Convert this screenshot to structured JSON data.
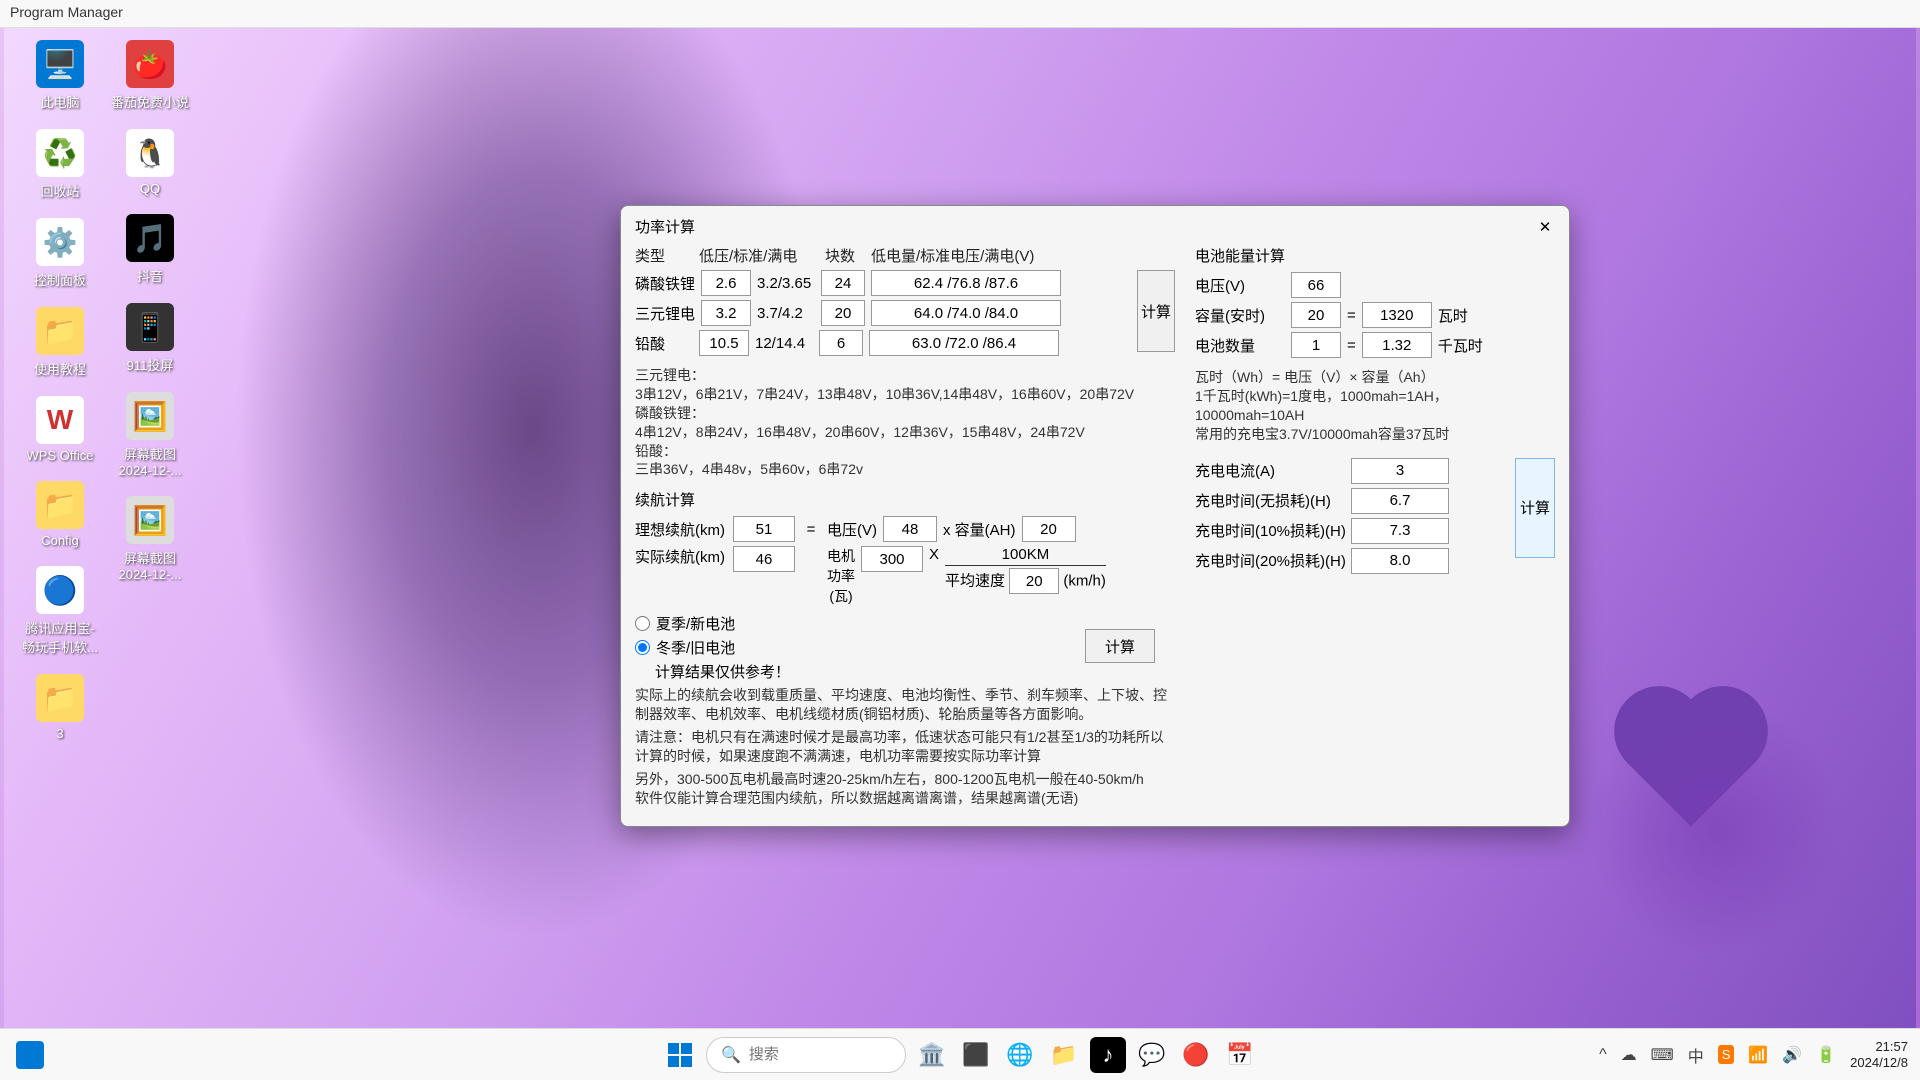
{
  "window_title": "Program Manager",
  "desktop": {
    "col1": [
      {
        "label": "此电脑"
      },
      {
        "label": "回收站"
      },
      {
        "label": "控制面板"
      },
      {
        "label": "使用教程"
      },
      {
        "label": "WPS Office"
      },
      {
        "label": "Config"
      },
      {
        "label": "腾讯应用宝-\n畅玩手机软..."
      },
      {
        "label": "3"
      }
    ],
    "col2": [
      {
        "label": "番茄免费小说"
      },
      {
        "label": "QQ"
      },
      {
        "label": "抖音"
      },
      {
        "label": "911投屏"
      },
      {
        "label": "屏幕截图\n2024-12-..."
      },
      {
        "label": "屏幕截图\n2024-12-..."
      }
    ]
  },
  "dialog": {
    "title": "功率计算",
    "power": {
      "hdr_type": "类型",
      "hdr_lsb": "低压/标准/满电",
      "hdr_blocks": "块数",
      "hdr_volt": "低电量/标准电压/满电(V)",
      "r1_label": "磷酸铁锂",
      "r1_v": "2.6",
      "r1_std": "3.2/3.65",
      "r1_blk": "24",
      "r1_out": "62.4 /76.8 /87.6",
      "r2_label": "三元锂电",
      "r2_v": "3.2",
      "r2_std": "3.7/4.2",
      "r2_blk": "20",
      "r2_out": "64.0 /74.0 /84.0",
      "r3_label": "铅酸",
      "r3_v": "10.5",
      "r3_std": "12/14.4",
      "r3_blk": "6",
      "r3_out": "63.0 /72.0 /86.4",
      "calc": "计算",
      "note1": "三元锂电：\n3串12V，6串21V，7串24V，13串48V，10串36V,14串48V，16串60V，20串72V\n磷酸铁锂：\n4串12V，8串24V，16串48V，20串60V，12串36V，15串48V，24串72V\n铅酸：\n三串36V，4串48v，5串60v，6串72v"
    },
    "range": {
      "title": "续航计算",
      "ideal_label": "理想续航(km)",
      "ideal": "51",
      "eq": "=",
      "volt_label": "电压(V)",
      "volt": "48",
      "cap_label": "x 容量(AH)",
      "cap": "20",
      "actual_label": "实际续航(km)",
      "actual": "46",
      "motor_label": "电机\n功率\n(瓦)",
      "motor": "300",
      "x": "X",
      "frac_top": "100KM",
      "speed_label": "平均速度",
      "speed": "20",
      "speed_unit": "(km/h)",
      "radio1": "夏季/新电池",
      "radio2": "冬季/旧电池",
      "calc": "计算",
      "ref": "计算结果仅供参考！",
      "note2": "实际上的续航会收到载重质量、平均速度、电池均衡性、季节、刹车频率、上下坡、控制器效率、电机效率、电机线缆材质(铜铝材质)、轮胎质量等各方面影响。",
      "note3": "请注意：电机只有在满速时候才是最高功率，低速状态可能只有1/2甚至1/3的功耗所以计算的时候，如果速度跑不满满速，电机功率需要按实际功率计算",
      "note4": "另外，300-500瓦电机最高时速20-25km/h左右，800-1200瓦电机一般在40-50km/h\n软件仅能计算合理范围内续航，所以数据越离谱离谱，结果越离谱(无语)"
    },
    "energy": {
      "title": "电池能量计算",
      "volt_label": "电压(V)",
      "volt": "66",
      "cap_label": "容量(安时)",
      "cap": "20",
      "eq1": "=",
      "wh": "1320",
      "wh_unit": "瓦时",
      "cnt_label": "电池数量",
      "cnt": "1",
      "eq2": "=",
      "kwh": "1.32",
      "kwh_unit": "千瓦时",
      "note": "瓦时（Wh）= 电压（V）× 容量（Ah）\n1千瓦时(kWh)=1度电，1000mah=1AH，10000mah=10AH\n常用的充电宝3.7V/10000mah容量37瓦时",
      "cur_label": "充电电流(A)",
      "cur": "3",
      "t0_label": "充电时间(无损耗)(H)",
      "t0": "6.7",
      "t10_label": "充电时间(10%损耗)(H)",
      "t10": "7.3",
      "t20_label": "充电时间(20%损耗)(H)",
      "t20": "8.0",
      "calc": "计算"
    }
  },
  "taskbar": {
    "search_placeholder": "搜索",
    "time": "21:57",
    "date": "2024/12/8"
  }
}
